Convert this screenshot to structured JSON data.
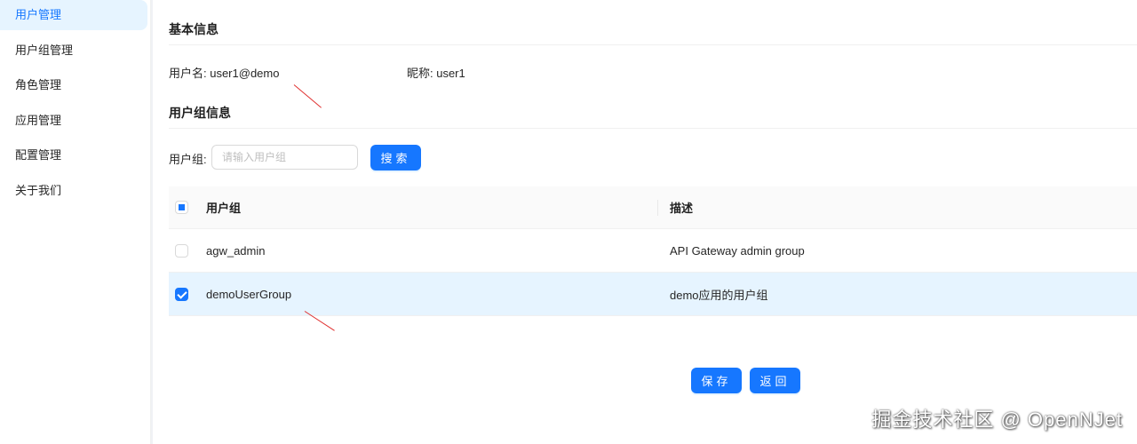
{
  "sidebar": {
    "items": [
      {
        "label": "用户管理"
      },
      {
        "label": "用户组管理"
      },
      {
        "label": "角色管理"
      },
      {
        "label": "应用管理"
      },
      {
        "label": "配置管理"
      },
      {
        "label": "关于我们"
      }
    ],
    "active_index": 0
  },
  "basic_info": {
    "title": "基本信息",
    "username": "用户名: user1@demo",
    "nickname": "昵称: user1"
  },
  "group_info": {
    "title": "用户组信息",
    "search_label": "用户组:",
    "search_placeholder": "请输入用户组",
    "search_value": "",
    "search_button": "搜索"
  },
  "table": {
    "columns": [
      "用户组",
      "描述"
    ],
    "rows": [
      {
        "name": "agw_admin",
        "description": "API Gateway admin group",
        "checked": false
      },
      {
        "name": "demoUserGroup",
        "description": "demo应用的用户组",
        "checked": true
      }
    ],
    "header_checkbox": "indeterminate"
  },
  "actions": {
    "save": "保存",
    "back": "返回"
  },
  "watermark": "掘金技术社区 @ OpenNJet",
  "colors": {
    "accent": "#1677ff",
    "selected_row": "#e6f4ff",
    "annotation_arrow": "#e0302f"
  }
}
